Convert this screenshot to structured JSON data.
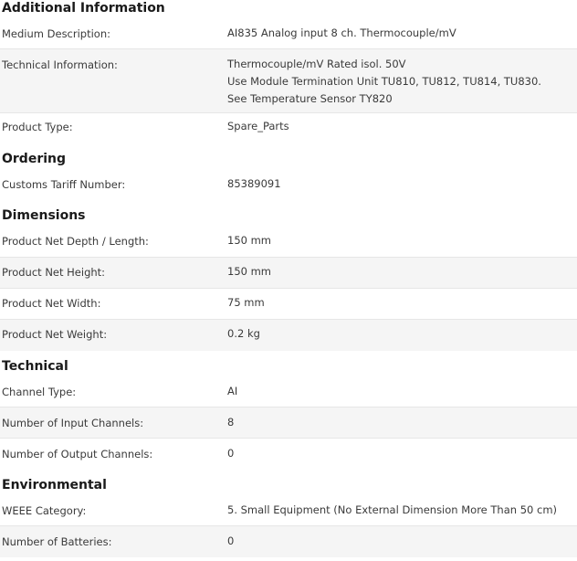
{
  "sections": {
    "additional": {
      "title": "Additional Information",
      "rows": [
        {
          "label": "Medium Description:",
          "value": "AI835 Analog input 8 ch. Thermocouple/mV"
        },
        {
          "label": "Technical Information:",
          "lines": [
            "Thermocouple/mV Rated isol. 50V",
            "Use Module Termination Unit TU810, TU812, TU814, TU830.",
            "See Temperature Sensor TY820"
          ]
        },
        {
          "label": "Product Type:",
          "value": "Spare_Parts"
        }
      ]
    },
    "ordering": {
      "title": "Ordering",
      "rows": [
        {
          "label": "Customs Tariff Number:",
          "value": "85389091"
        }
      ]
    },
    "dimensions": {
      "title": "Dimensions",
      "rows": [
        {
          "label": "Product Net Depth / Length:",
          "value": "150 mm"
        },
        {
          "label": "Product Net Height:",
          "value": "150 mm"
        },
        {
          "label": "Product Net Width:",
          "value": "75 mm"
        },
        {
          "label": "Product Net Weight:",
          "value": "0.2 kg"
        }
      ]
    },
    "technical": {
      "title": "Technical",
      "rows": [
        {
          "label": "Channel Type:",
          "value": "AI"
        },
        {
          "label": "Number of Input Channels:",
          "value": "8"
        },
        {
          "label": "Number of Output Channels:",
          "value": "0"
        }
      ]
    },
    "environmental": {
      "title": "Environmental",
      "rows": [
        {
          "label": "WEEE Category:",
          "value": "5. Small Equipment (No External Dimension More Than 50 cm)"
        },
        {
          "label": "Number of Batteries:",
          "value": "0"
        }
      ]
    }
  }
}
